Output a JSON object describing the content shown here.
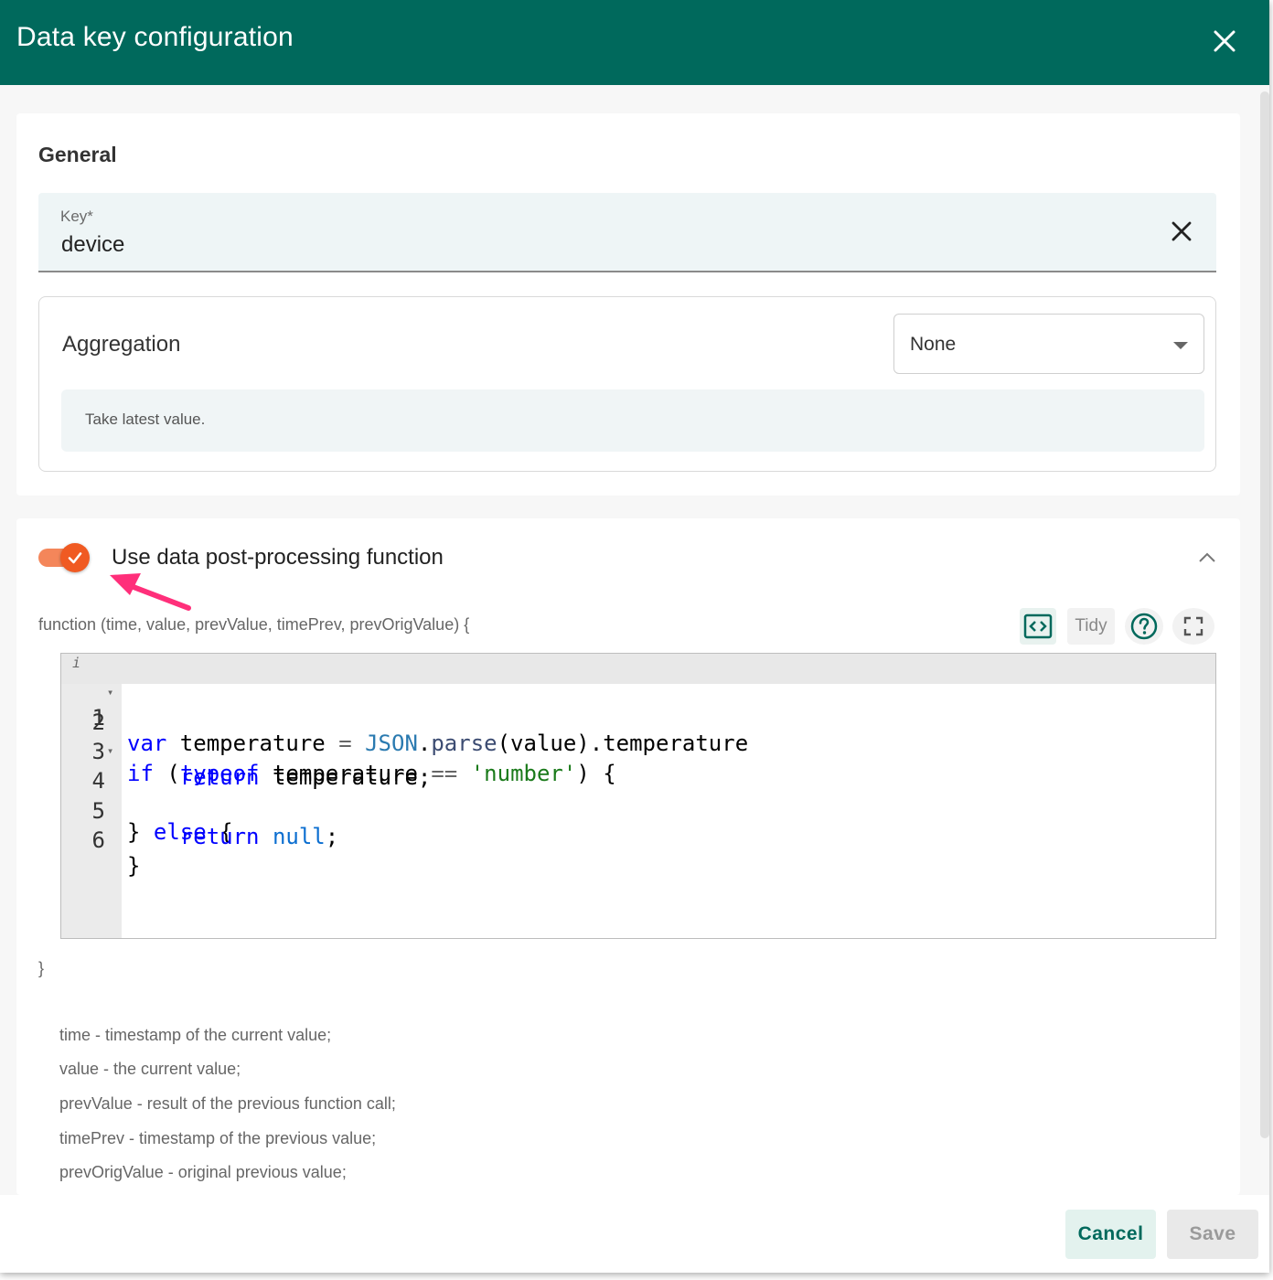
{
  "dialog": {
    "title": "Data key configuration",
    "close_icon": "close-icon",
    "accent_color": "#00695c"
  },
  "general": {
    "section_title": "General",
    "key": {
      "label": "Key*",
      "value": "device"
    },
    "aggregation": {
      "label": "Aggregation",
      "selected": "None",
      "hint": "Take latest value."
    }
  },
  "post_processing": {
    "toggle_on": true,
    "toggle_color": "#f05a22",
    "label": "Use data post-processing function",
    "signature": "function (time, value, prevValue, timePrev, prevOrigValue) {",
    "toolbar": {
      "tidy_label": "Tidy"
    },
    "code_lines": [
      "var temperature = JSON.parse(value).temperature",
      "if (typeof temperature == 'number') {",
      "    return temperature;",
      "} else {",
      "    return null;",
      "}"
    ],
    "line_numbers": [
      "1",
      "2",
      "3",
      "4",
      "5",
      "6"
    ],
    "closing_brace": "}",
    "params": [
      "time - timestamp of the current value;",
      "value - the current value;",
      "prevValue - result of the previous function call;",
      "timePrev - timestamp of the previous value;",
      "prevOrigValue - original previous value;"
    ]
  },
  "footer": {
    "cancel_label": "Cancel",
    "save_label": "Save"
  }
}
